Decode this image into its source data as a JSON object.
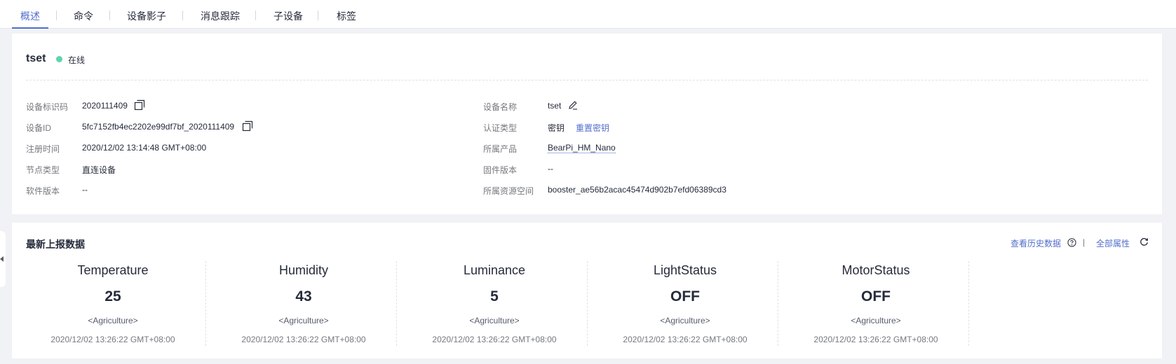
{
  "tabs": [
    {
      "label": "概述",
      "active": true
    },
    {
      "label": "命令",
      "active": false
    },
    {
      "label": "设备影子",
      "active": false
    },
    {
      "label": "消息跟踪",
      "active": false
    },
    {
      "label": "子设备",
      "active": false
    },
    {
      "label": "标签",
      "active": false
    }
  ],
  "device": {
    "name": "tset",
    "status": "在线",
    "status_color": "#5ed5a8"
  },
  "info_left": [
    {
      "label": "设备标识码",
      "value": "2020111409",
      "copy_icon": "copy-icon"
    },
    {
      "label": "设备ID",
      "value": "5fc7152fb4ec2202e99df7bf_2020111409",
      "copy_icon": "copy-icon"
    },
    {
      "label": "注册时间",
      "value": "2020/12/02 13:14:48 GMT+08:00"
    },
    {
      "label": "节点类型",
      "value": "直连设备"
    },
    {
      "label": "软件版本",
      "value": "--"
    }
  ],
  "info_right": [
    {
      "label": "设备名称",
      "value": "tset",
      "edit_icon": "edit-icon"
    },
    {
      "label": "认证类型",
      "value": "密钥",
      "action": "重置密钥"
    },
    {
      "label": "所属产品",
      "value": "BearPi_HM_Nano"
    },
    {
      "label": "固件版本",
      "value": "--"
    },
    {
      "label": "所属资源空间",
      "value": "booster_ae56b2acac45474d902b7efd06389cd3"
    }
  ],
  "latest": {
    "title": "最新上报数据",
    "history_link": "查看历史数据",
    "all_props_link": "全部属性",
    "separator": "|",
    "metrics": [
      {
        "name": "Temperature",
        "value": "25",
        "service": "<Agriculture>",
        "time": "2020/12/02 13:26:22 GMT+08:00"
      },
      {
        "name": "Humidity",
        "value": "43",
        "service": "<Agriculture>",
        "time": "2020/12/02 13:26:22 GMT+08:00"
      },
      {
        "name": "Luminance",
        "value": "5",
        "service": "<Agriculture>",
        "time": "2020/12/02 13:26:22 GMT+08:00"
      },
      {
        "name": "LightStatus",
        "value": "OFF",
        "service": "<Agriculture>",
        "time": "2020/12/02 13:26:22 GMT+08:00"
      },
      {
        "name": "MotorStatus",
        "value": "OFF",
        "service": "<Agriculture>",
        "time": "2020/12/02 13:26:22 GMT+08:00"
      }
    ]
  },
  "colors": {
    "accent": "#526ecc",
    "page_bg": "#f1f2f5",
    "card_bg": "#ffffff"
  }
}
